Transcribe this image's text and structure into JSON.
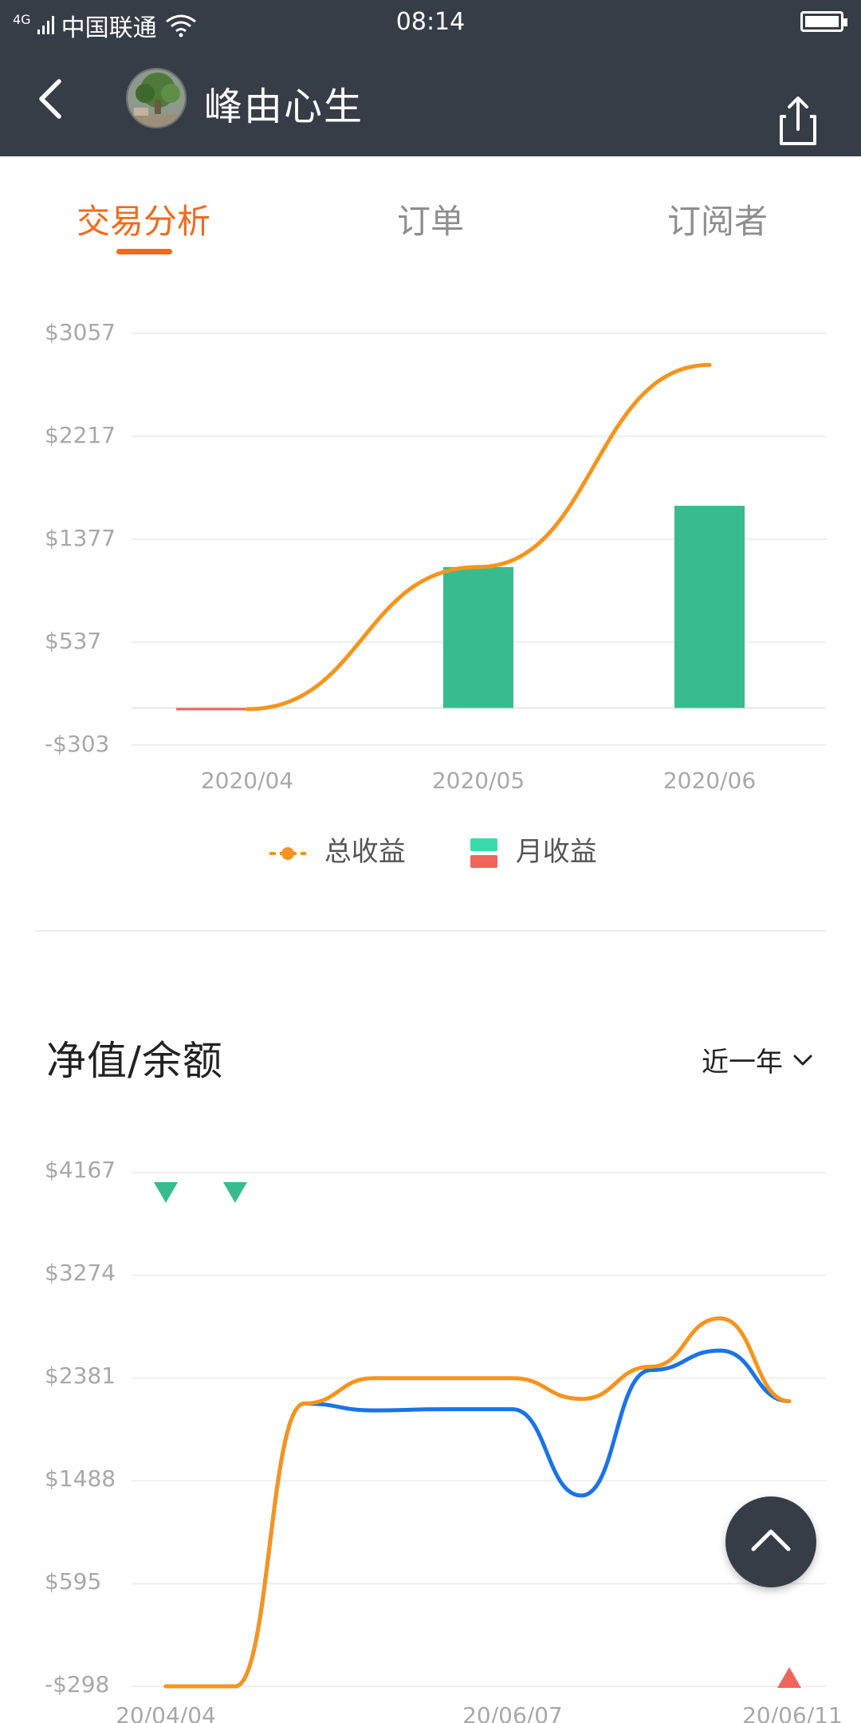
{
  "status_bar": {
    "network": "4G",
    "carrier": "中国联通",
    "time": "08:14"
  },
  "header": {
    "title": "峰由心生",
    "back_icon": "chevron-left-icon",
    "share_icon": "share-icon"
  },
  "tabs": [
    {
      "label": "交易分析",
      "active": true
    },
    {
      "label": "订单",
      "active": false
    },
    {
      "label": "订阅者",
      "active": false
    }
  ],
  "colors": {
    "header_bg": "#373d47",
    "accent": "#f06a1c",
    "orange_line": "#f7941d",
    "green_bar": "#37bb8f",
    "red_bar": "#f0645a",
    "blue_line": "#1a73e8"
  },
  "chart_data": [
    {
      "type": "bar",
      "categories": [
        "2020/04",
        "2020/05",
        "2020/06"
      ],
      "series": [
        {
          "name": "总收益",
          "kind": "line",
          "values": [
            -303,
            1150,
            2800
          ]
        },
        {
          "name": "月收益",
          "kind": "bar",
          "values": [
            -10,
            1150,
            1650
          ]
        }
      ],
      "y_ticks": [
        "$3057",
        "$2217",
        "$1377",
        "$537",
        "-$303"
      ],
      "ylim": [
        -303,
        3057
      ],
      "legend": [
        "总收益",
        "月收益"
      ],
      "legend_position": "bottom",
      "grid": true
    },
    {
      "type": "line",
      "title": "净值/余额",
      "range": "近一年",
      "x_ticks": [
        "20/04/04",
        "20/06/07",
        "20/06/11"
      ],
      "y_ticks": [
        "$4167",
        "$3274",
        "$2381",
        "$1488",
        "$595",
        "-$298"
      ],
      "ylim": [
        -298,
        4167
      ],
      "series": [
        {
          "name": "orange",
          "values": [
            -298,
            -298,
            2160,
            2380,
            2380,
            2380,
            2200,
            2480,
            2900,
            2180
          ]
        },
        {
          "name": "blue",
          "values": [
            -298,
            -298,
            2160,
            2100,
            2110,
            2110,
            1360,
            2450,
            2620,
            2180
          ]
        }
      ],
      "markers": [
        {
          "type": "down-triangle",
          "color": "#37bb8f",
          "x_index": 0
        },
        {
          "type": "down-triangle",
          "color": "#37bb8f",
          "x_index": 1
        },
        {
          "type": "up-triangle",
          "color": "#f0645a",
          "x_index": 9
        }
      ],
      "grid": true
    }
  ],
  "section": {
    "title": "净值/余额",
    "range_label": "近一年"
  }
}
